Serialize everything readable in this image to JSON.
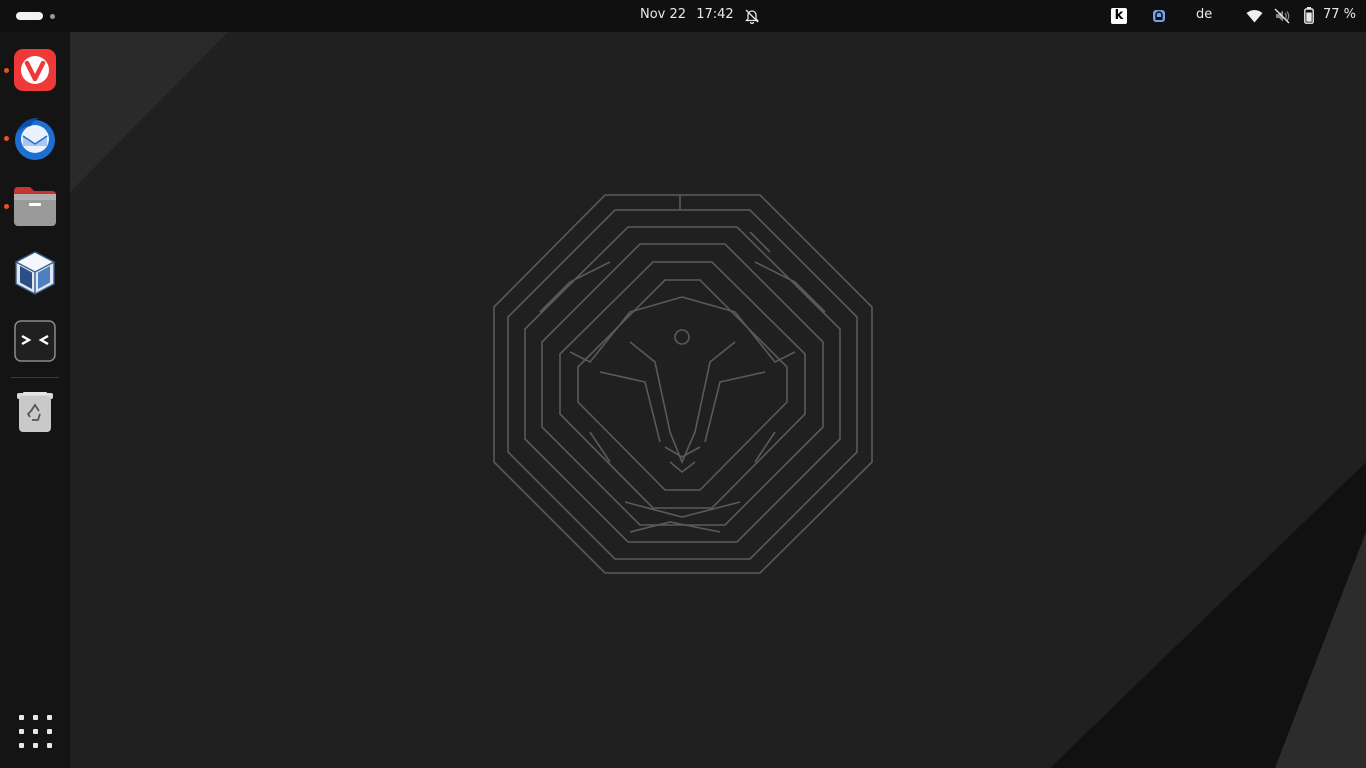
{
  "topbar": {
    "date": "Nov 22",
    "time": "17:42",
    "keyboard_layout": "de",
    "battery_percent": "77 %",
    "tray_k_label": "k",
    "icons": [
      "activities-indicator",
      "bell-off-icon",
      "k-tray-icon",
      "vpn-lock-icon",
      "wifi-icon",
      "volume-muted-icon",
      "battery-icon"
    ]
  },
  "dock": {
    "items": [
      {
        "name": "Vivaldi",
        "icon": "vivaldi-icon",
        "running": true
      },
      {
        "name": "Thunderbird",
        "icon": "thunderbird-icon",
        "running": true
      },
      {
        "name": "Files",
        "icon": "files-icon",
        "running": true
      },
      {
        "name": "VirtualBox",
        "icon": "virtualbox-icon",
        "running": false
      },
      {
        "name": "Remmina",
        "icon": "terminal-remote-icon",
        "running": false
      },
      {
        "name": "Trash",
        "icon": "trash-icon",
        "running": false
      }
    ],
    "show_apps_icon": "show-apps-grid-icon"
  },
  "colors": {
    "accent": "#e95420",
    "topbar_bg": "#101010",
    "dock_bg": "#141414",
    "wallpaper_bg": "#1f1f1f"
  }
}
